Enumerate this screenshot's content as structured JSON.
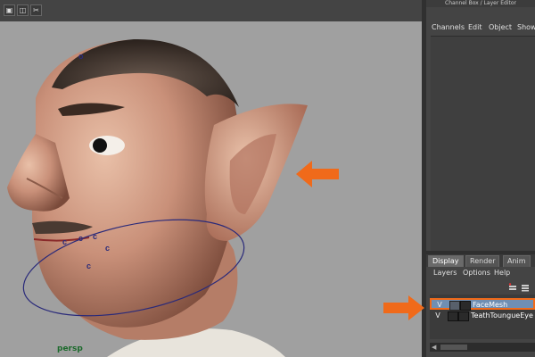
{
  "viewport": {
    "camera_label": "persp",
    "toolbar_icons": [
      "cube-icon",
      "cubes-icon",
      "scissors-icon"
    ]
  },
  "panel": {
    "title": "Channel Box / Layer Editor",
    "menu": [
      "Channels",
      "Edit",
      "Object",
      "Show"
    ]
  },
  "layer_editor": {
    "tabs": [
      "Display",
      "Render",
      "Anim"
    ],
    "active_tab": "Display",
    "submenu": [
      "Layers",
      "Options",
      "Help"
    ],
    "layers": [
      {
        "visibility": "V",
        "name": "FaceMesh",
        "selected": true
      },
      {
        "visibility": "V",
        "name": "TeathToungueEye",
        "selected": false
      }
    ]
  },
  "colors": {
    "annotation_arrow": "#f06a1a",
    "selection_highlight": "#6f8fb3",
    "viewport_bg": "#a0a0a0"
  }
}
